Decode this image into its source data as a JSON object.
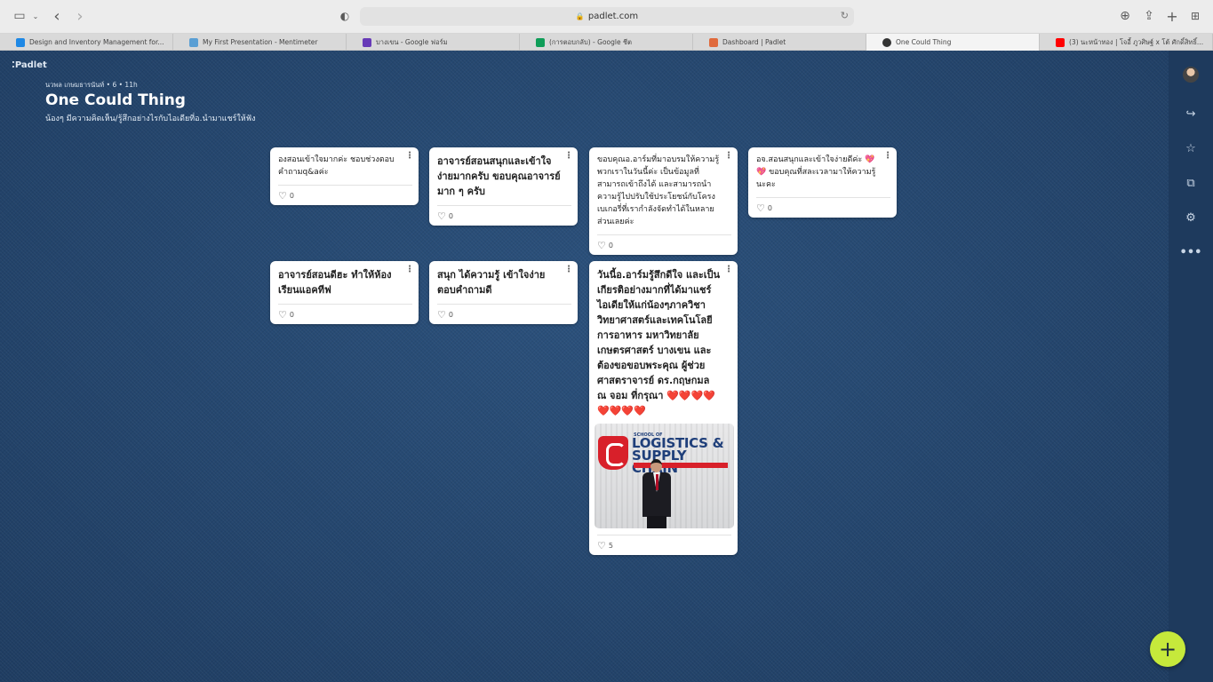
{
  "browser": {
    "url": "padlet.com",
    "tabs": [
      {
        "label": "Design and Inventory Management for...",
        "color": "#1e88e5"
      },
      {
        "label": "My First Presentation - Mentimeter",
        "color": "#5a9fd4"
      },
      {
        "label": "บางเขน - Google ฟอร์ม",
        "color": "#673ab7"
      },
      {
        "label": "(การตอบกลับ) - Google ชีต",
        "color": "#0f9d58"
      },
      {
        "label": "Dashboard | Padlet",
        "color": "#e06a3c"
      },
      {
        "label": "One Could Thing",
        "color": "#333333"
      },
      {
        "label": "(3) นะหน้าทอง | โจอี้ ภูวศิษฐ์ x โต้ ศักดิ์สิทธิ์...",
        "color": "#ff0000"
      }
    ]
  },
  "board": {
    "logo": "Padlet",
    "meta": "นวพล เกษมธารนันท์ • 6 • 11h",
    "title": "One Could Thing",
    "subtitle": "น้องๆ มีความคิดเห็น/รู้สึกอย่างไรกับไอเดียที่อ.นำมาแชร์ให้ฟัง"
  },
  "posts": [
    {
      "text": "องสอนเข้าใจมากค่ะ ชอบช่วงตอบคำถามq&aค่ะ",
      "likes": "0"
    },
    {
      "text": "อาจารย์สอนสนุกและเข้าใจง่ายมากครับ ขอบคุณอาจารย์มาก ๆ ครับ",
      "likes": "0"
    },
    {
      "text": "ขอบคุณอ.อาร์มที่มาอบรมให้ความรู้พวกเราในวันนี้ค่ะ เป็นข้อมูลที่สามารถเข้าถึงได้ และสามารถนำความรู้ไปปรับใช้ประโยชน์กับโครงเบเกอรี่ที่เรากำลังจัดทำได้ในหลายส่วนเลยค่ะ",
      "likes": "0"
    },
    {
      "text": "อจ.สอนสนุกและเข้าใจง่ายดีค่ะ 💖💖 ขอบคุณที่สละเวลามาให้ความรู้นะคะ",
      "likes": "0"
    },
    {
      "text": "อาจารย์สอนดีฮะ ทำให้ห้องเรียนแอคทีฟ",
      "likes": "0"
    },
    {
      "text": "สนุก ได้ความรู้ เข้าใจง่าย ตอบคำถามดี",
      "likes": "0"
    },
    {
      "text": "วันนี้อ.อาร์มรู้สึกดีใจ และเป็นเกียรติอย่างมากที่ได้มาแชร์ไอเดียให้แก่น้องๆภาควิชาวิทยาศาสตร์และเทคโนโลยีการอาหาร มหาวิทยาลัยเกษตรศาสตร์ บางเขน และต้องขอขอบพระคุณ ผู้ช่วยศาสตราจารย์ ดร.กฤษกมล ณ จอม ที่กรุณา ❤️❤️❤️❤️❤️❤️❤️❤️",
      "likes": "5",
      "photo": {
        "line1": "SCHOOL OF",
        "line2": "LOGISTICS &",
        "line3": "SUPPLY CHAIN"
      }
    }
  ],
  "add_button": "+"
}
